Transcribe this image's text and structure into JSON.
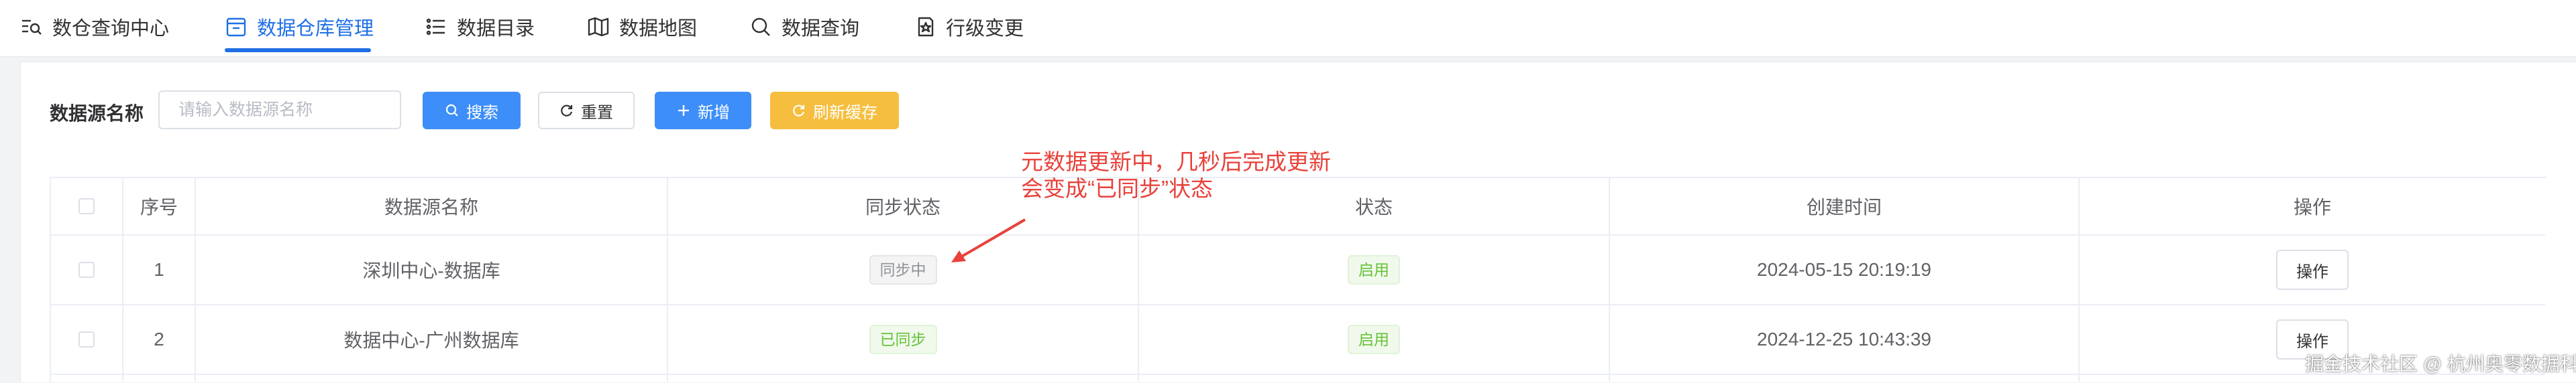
{
  "nav": {
    "tabs": [
      {
        "label": "数仓查询中心",
        "icon": "search-list-icon"
      },
      {
        "label": "数据仓库管理",
        "icon": "warehouse-box-icon",
        "active": true
      },
      {
        "label": "数据目录",
        "icon": "list-icon"
      },
      {
        "label": "数据地图",
        "icon": "map-icon"
      },
      {
        "label": "数据查询",
        "icon": "search-icon"
      },
      {
        "label": "行级变更",
        "icon": "edit-doc-icon"
      }
    ],
    "accent_color": "#1f6fe5"
  },
  "filter": {
    "label": "数据源名称",
    "placeholder": "请输入数据源名称",
    "search_label": "搜索",
    "reset_label": "重置",
    "add_label": "新增",
    "refresh_label": "刷新缓存"
  },
  "table": {
    "headers": {
      "index": "序号",
      "name": "数据源名称",
      "sync": "同步状态",
      "status": "状态",
      "created": "创建时间",
      "actions": "操作"
    },
    "rows": [
      {
        "index": "1",
        "name": "深圳中心-数据库",
        "sync": "同步中",
        "status": "启用",
        "created": "2024-05-15 20:19:19",
        "action": "操作"
      },
      {
        "index": "2",
        "name": "数据中心-广州数据库",
        "sync": "已同步",
        "status": "启用",
        "created": "2024-12-25 10:43:39",
        "action": "操作"
      }
    ]
  },
  "annotation": {
    "line1": "元数据更新中，几秒后完成更新",
    "line2": "会变成“已同步”状态",
    "color": "#e8423b"
  },
  "watermark": "掘金技术社区 @ 杭州奥零数据科技"
}
